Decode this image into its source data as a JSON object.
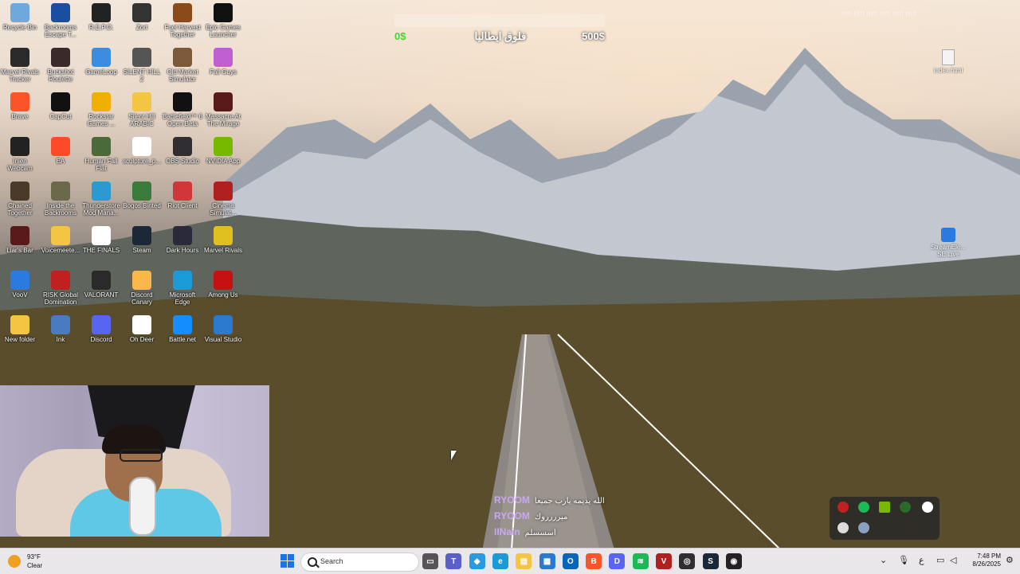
{
  "desktop": {
    "icons": [
      {
        "label": "Recycle Bin",
        "icon": "recycle-bin-icon",
        "color": "#6fa8dc"
      },
      {
        "label": "Backrooms Escape T...",
        "icon": "backrooms-icon",
        "color": "#1a4fa0"
      },
      {
        "label": "R.E.P.O.",
        "icon": "repo-icon",
        "color": "#222222"
      },
      {
        "label": "Zort",
        "icon": "zort-icon",
        "color": "#333333"
      },
      {
        "label": "Fuel Harvest Together",
        "icon": "fuel-harvest-icon",
        "color": "#8b4a1a"
      },
      {
        "label": "Epic Games Launcher",
        "icon": "epic-games-icon",
        "color": "#111111"
      },
      {
        "label": "Marvel Rivals Tracker",
        "icon": "marvel-tracker-icon",
        "color": "#2a2a2a"
      },
      {
        "label": "Buckshot Roulette",
        "icon": "buckshot-icon",
        "color": "#3a2a2a"
      },
      {
        "label": "GameLoop",
        "icon": "gameloop-icon",
        "color": "#3a8de0"
      },
      {
        "label": "SILENT HILL 2",
        "icon": "silent-hill-icon",
        "color": "#555555"
      },
      {
        "label": "Old Market Simulator",
        "icon": "old-market-icon",
        "color": "#7a5a3a"
      },
      {
        "label": "Fall Guys",
        "icon": "fall-guys-icon",
        "color": "#c060d0"
      },
      {
        "label": "Brave",
        "icon": "brave-icon",
        "color": "#fb542b"
      },
      {
        "label": "CapCut",
        "icon": "capcut-icon",
        "color": "#111111"
      },
      {
        "label": "Rockstar Games ...",
        "icon": "rockstar-icon",
        "color": "#f0b000"
      },
      {
        "label": "Silent Hill ARABIC",
        "icon": "folder-icon",
        "color": "#f4c542"
      },
      {
        "label": "Battlefield™ 6 Open Beta",
        "icon": "battlefield-icon",
        "color": "#111111"
      },
      {
        "label": "Massacre At The Mirage",
        "icon": "massacre-icon",
        "color": "#5a1a1a"
      },
      {
        "label": "Inlen Webcam",
        "icon": "webcam-icon",
        "color": "#222222"
      },
      {
        "label": "EA",
        "icon": "ea-icon",
        "color": "#ff4a2a"
      },
      {
        "label": "Human Fall Flat",
        "icon": "human-fall-flat-icon",
        "color": "#4a6a3a"
      },
      {
        "label": "sculpture_p...",
        "icon": "file-icon",
        "color": "#ffffff"
      },
      {
        "label": "OBS Studio",
        "icon": "obs-icon",
        "color": "#302e31"
      },
      {
        "label": "NVIDIA App",
        "icon": "nvidia-icon",
        "color": "#76b900"
      },
      {
        "label": "Chained Together",
        "icon": "chained-together-icon",
        "color": "#4a3a2a"
      },
      {
        "label": "Inside the Backrooms",
        "icon": "inside-backrooms-icon",
        "color": "#6a6a4a"
      },
      {
        "label": "Thunderstore Mod Mana...",
        "icon": "thunderstore-icon",
        "color": "#2a9ad0"
      },
      {
        "label": "Bogos Binted",
        "icon": "bogos-icon",
        "color": "#3a7a3a"
      },
      {
        "label": "Riot Client",
        "icon": "riot-icon",
        "color": "#d13639"
      },
      {
        "label": "Cinema Simulat...",
        "icon": "cinema-icon",
        "color": "#b02020"
      },
      {
        "label": "Liar's Bar",
        "icon": "liars-bar-icon",
        "color": "#5a1a1a"
      },
      {
        "label": "Voicemeete...",
        "icon": "folder-icon",
        "color": "#f4c542"
      },
      {
        "label": "THE FINALS",
        "icon": "the-finals-icon",
        "color": "#ffffff"
      },
      {
        "label": "Steam",
        "icon": "steam-icon",
        "color": "#1b2838"
      },
      {
        "label": "Dark Hours",
        "icon": "dark-hours-icon",
        "color": "#2a2a3a"
      },
      {
        "label": "Marvel Rivals",
        "icon": "marvel-rivals-icon",
        "color": "#e0c020"
      },
      {
        "label": "VooV",
        "icon": "voov-icon",
        "color": "#2a7ae0"
      },
      {
        "label": "RISK Global Domination",
        "icon": "risk-icon",
        "color": "#c02020"
      },
      {
        "label": "VALORANT",
        "icon": "valorant-icon",
        "color": "#2a2a2a"
      },
      {
        "label": "Discord Canary",
        "icon": "discord-canary-icon",
        "color": "#fbb848"
      },
      {
        "label": "Microsoft Edge",
        "icon": "edge-icon",
        "color": "#1a9ad6"
      },
      {
        "label": "Among Us",
        "icon": "among-us-icon",
        "color": "#c51111"
      },
      {
        "label": "New folder",
        "icon": "folder-icon",
        "color": "#f4c542"
      },
      {
        "label": "Ink",
        "icon": "ink-icon",
        "color": "#4a7ac0"
      },
      {
        "label": "Discord",
        "icon": "discord-icon",
        "color": "#5865f2"
      },
      {
        "label": "Oh Deer",
        "icon": "oh-deer-icon",
        "color": "#ffffff"
      },
      {
        "label": "Battle.net",
        "icon": "battlenet-icon",
        "color": "#148eff"
      },
      {
        "label": "Visual Studio",
        "icon": "vscode-icon",
        "color": "#2a7ad0"
      }
    ],
    "right_icons": [
      {
        "label": "index.html",
        "icon": "file-icon"
      },
      {
        "label": "StreamEle... SE.Live",
        "icon": "streamelements-icon"
      }
    ]
  },
  "donation": {
    "title": "فلوق ايطاليا",
    "current": "0$",
    "goal": "500$",
    "progress": 0
  },
  "overlay_top_right": "!!!!! !!!!! !!!!! !!!!! !!!!! !!!!!",
  "chat": [
    {
      "user": "RYOOM",
      "message": "الله يديمه يارب جميعا"
    },
    {
      "user": "RYOOM",
      "message": "ميرررروك"
    },
    {
      "user": "IINain",
      "message": "اسسسلم"
    }
  ],
  "taskbar": {
    "weather": {
      "temp": "93°F",
      "condition": "Clear"
    },
    "search_placeholder": "Search",
    "apps": [
      {
        "name": "task-view-icon",
        "color": "#555555",
        "glyph": "▭"
      },
      {
        "name": "teams-icon",
        "color": "#5b5fc7",
        "glyph": "T"
      },
      {
        "name": "copilot-icon",
        "color": "#2a9ae0",
        "glyph": "◆"
      },
      {
        "name": "edge-icon",
        "color": "#1a9ad6",
        "glyph": "e"
      },
      {
        "name": "file-explorer-icon",
        "color": "#f4c542",
        "glyph": "▤"
      },
      {
        "name": "store-icon",
        "color": "#2a7ad0",
        "glyph": "▦"
      },
      {
        "name": "outlook-icon",
        "color": "#0a64b8",
        "glyph": "O"
      },
      {
        "name": "brave-icon",
        "color": "#fb542b",
        "glyph": "B"
      },
      {
        "name": "discord-icon",
        "color": "#5865f2",
        "glyph": "D"
      },
      {
        "name": "spotify-icon",
        "color": "#1db954",
        "glyph": "≋"
      },
      {
        "name": "voicemeeter-icon",
        "color": "#b02020",
        "glyph": "V"
      },
      {
        "name": "obs-icon",
        "color": "#302e31",
        "glyph": "◎"
      },
      {
        "name": "steam-icon",
        "color": "#1b2838",
        "glyph": "S"
      },
      {
        "name": "webcam-icon",
        "color": "#222222",
        "glyph": "◉"
      }
    ],
    "lang": "ع",
    "time": "7:48 PM",
    "date": "8/26/2025"
  }
}
